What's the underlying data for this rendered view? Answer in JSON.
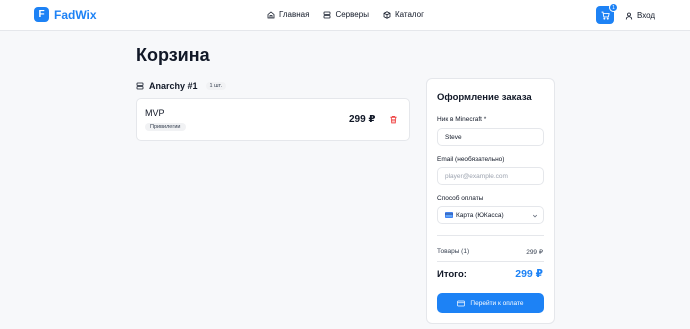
{
  "header": {
    "logo_letter": "F",
    "logo_text": "FadWix",
    "nav": [
      {
        "label": "Главная",
        "icon": "home-icon"
      },
      {
        "label": "Серверы",
        "icon": "server-icon"
      },
      {
        "label": "Каталог",
        "icon": "box-icon"
      }
    ],
    "cart_count": "1",
    "login_label": "Вход"
  },
  "page": {
    "title": "Корзина"
  },
  "cart": {
    "server_name": "Anarchy #1",
    "quantity_label": "1 шт.",
    "items": [
      {
        "name": "MVP",
        "category": "Привилегии",
        "price": "299 ₽"
      }
    ]
  },
  "checkout": {
    "title": "Оформление заказа",
    "nick_label": "Ник в Minecraft *",
    "nick_value": "Steve",
    "email_label": "Email (необязательно)",
    "email_placeholder": "player@example.com",
    "payment_label": "Способ оплаты",
    "payment_value": "Карта (ЮКасса)",
    "subtotal_label": "Товары (1)",
    "subtotal_value": "299 ₽",
    "total_label": "Итого:",
    "total_value": "299 ₽",
    "pay_button": "Перейти к оплате"
  },
  "colors": {
    "accent": "#1d82f5",
    "danger": "#ef4444"
  }
}
